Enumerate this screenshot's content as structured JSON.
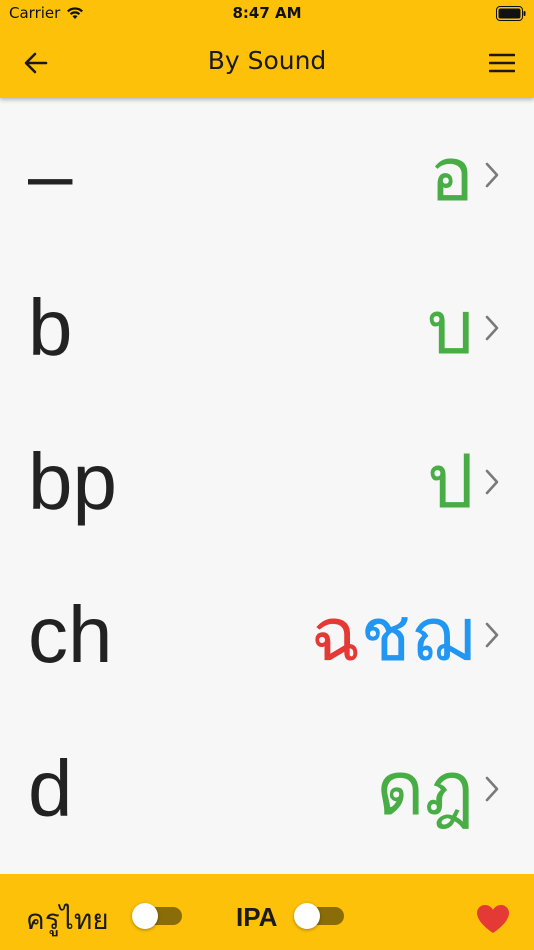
{
  "status_bar": {
    "carrier": "Carrier",
    "time": "8:47 AM"
  },
  "toolbar": {
    "title": "By Sound",
    "back_icon": "arrow-left-icon",
    "menu_icon": "hamburger-menu-icon"
  },
  "rows": [
    {
      "sound": "–",
      "letters": [
        {
          "char": "อ",
          "class": "mid"
        }
      ]
    },
    {
      "sound": "b",
      "letters": [
        {
          "char": "บ",
          "class": "mid"
        }
      ]
    },
    {
      "sound": "bp",
      "letters": [
        {
          "char": "ป",
          "class": "mid"
        }
      ]
    },
    {
      "sound": "ch",
      "letters": [
        {
          "char": "ฉ",
          "class": "high"
        },
        {
          "char": "ช",
          "class": "low"
        },
        {
          "char": "ฌ",
          "class": "low"
        }
      ]
    },
    {
      "sound": "d",
      "letters": [
        {
          "char": "ด",
          "class": "mid"
        },
        {
          "char": "ฎ",
          "class": "mid"
        }
      ]
    }
  ],
  "class_colors": {
    "mid": "#49ad45",
    "high": "#e53935",
    "low": "#2196f3"
  },
  "footer": {
    "thai_label": "ครูไทย",
    "ipa_label": "IPA",
    "thai_toggle_on": false,
    "ipa_toggle_on": false,
    "favorite_icon": "heart-icon",
    "favorite_color": "#e53935"
  },
  "colors": {
    "accent": "#fdc10a"
  }
}
